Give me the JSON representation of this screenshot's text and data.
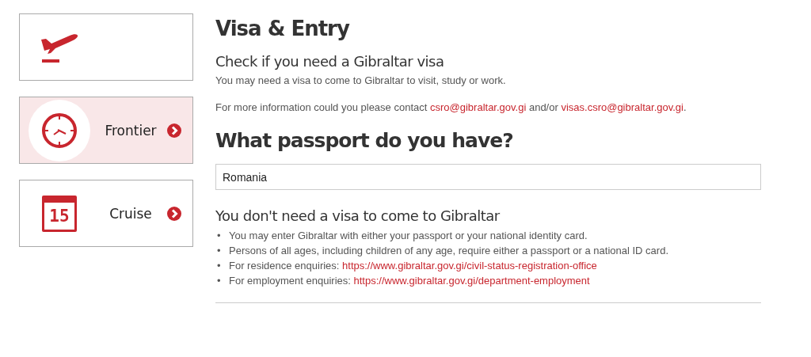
{
  "sidebar": {
    "items": [
      {
        "kind": "plane",
        "selected": false
      },
      {
        "kind": "clock",
        "label": "Frontier",
        "selected": true
      },
      {
        "kind": "calendar",
        "label": "Cruise",
        "selected": false,
        "icon_text": "15"
      }
    ]
  },
  "main": {
    "title": "Visa & Entry",
    "subtitle": "Check if you need a Gibraltar visa",
    "paragraphs": [
      [
        {
          "text": "You may need a visa to come to Gibraltar to visit, study or work."
        }
      ],
      [
        {
          "text": "For more information could you please contact "
        },
        {
          "link": "csro@gibraltar.gov.gi"
        },
        {
          "text": " and/or "
        },
        {
          "link": "visas.csro@gibraltar.gov.gi"
        },
        {
          "text": "."
        }
      ]
    ],
    "question": "What passport do you have?",
    "passport_field": {
      "value": "Romania"
    },
    "result_heading": "You don't need a visa to come to Gibraltar",
    "bullets": [
      {
        "marker": "•",
        "parts": [
          {
            "text": "You may enter Gibraltar with either your passport or your national identity card."
          }
        ]
      },
      {
        "marker": "•",
        "parts": [
          {
            "text": "Persons of all ages, including children of any age, require either a passport or a national ID card."
          }
        ]
      },
      {
        "marker": "•",
        "parts": [
          {
            "text": "For residence enquiries: "
          },
          {
            "link": "https://www.gibraltar.gov.gi/civil-status-registration-office"
          }
        ]
      },
      {
        "marker": "•",
        "parts": [
          {
            "text": "For employment enquiries: "
          },
          {
            "link": "https://www.gibraltar.gov.gi/department-employment"
          }
        ]
      }
    ]
  }
}
